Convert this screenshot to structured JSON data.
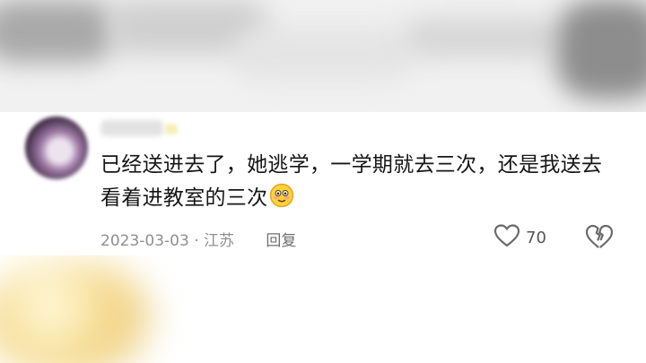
{
  "comment": {
    "lines": [
      "已经送进去了，她逃学，一学期就去三次，还是我送去",
      "看着进教室的三次"
    ],
    "emoji": "blushing-smile-emoji",
    "date": "2023-03-03",
    "separator": " · ",
    "location": "江苏",
    "reply_label": "回复",
    "like_count": "70"
  },
  "icons": {
    "like": "heart-outline-icon",
    "dislike": "broken-heart-icon"
  }
}
